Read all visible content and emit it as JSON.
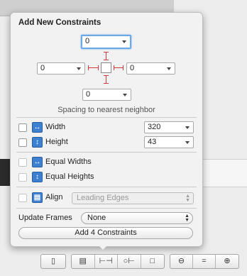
{
  "popover": {
    "title": "Add New Constraints",
    "spacing": {
      "top": "0",
      "left": "0",
      "right": "0",
      "bottom": "0"
    },
    "caption": "Spacing to nearest neighbor",
    "width": {
      "label": "Width",
      "value": "320"
    },
    "height": {
      "label": "Height",
      "value": "43"
    },
    "equal_widths": {
      "label": "Equal Widths"
    },
    "equal_heights": {
      "label": "Equal Heights"
    },
    "align": {
      "label": "Align",
      "value": "Leading Edges"
    },
    "update_frames": {
      "label": "Update Frames",
      "value": "None"
    },
    "add_button": "Add 4 Constraints"
  },
  "toolbar": {
    "groups": [
      [
        "fixed-device-icon"
      ],
      [
        "align-icon",
        "pin-icon",
        "resolve-icon",
        "resize-icon"
      ],
      [
        "zoom-out-icon",
        "equal-zoom-icon",
        "zoom-in-icon"
      ]
    ]
  }
}
